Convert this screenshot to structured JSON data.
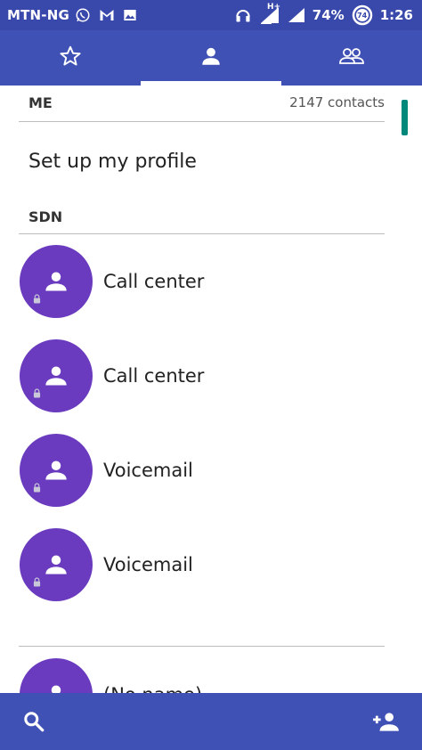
{
  "status_bar": {
    "carrier": "MTN-NG",
    "network": "H+",
    "battery": "74%",
    "battery_saver_level": "74",
    "time": "1:26"
  },
  "tabs": [
    {
      "icon": "star-icon"
    },
    {
      "icon": "person-icon",
      "selected": true
    },
    {
      "icon": "group-icon"
    }
  ],
  "me_section": {
    "header": "ME",
    "contact_count": "2147 contacts",
    "profile_label": "Set up my profile"
  },
  "sdn_section": {
    "header": "SDN",
    "contacts": [
      {
        "name": "Call center"
      },
      {
        "name": "Call center"
      },
      {
        "name": "Voicemail"
      },
      {
        "name": "Voicemail"
      }
    ]
  },
  "other_contacts": [
    {
      "name": "(No name)"
    }
  ],
  "colors": {
    "status_bar": "#3949ab",
    "app_bar": "#3f51b5",
    "avatar": "#6a3bbf",
    "scrollbar": "#00897b"
  }
}
